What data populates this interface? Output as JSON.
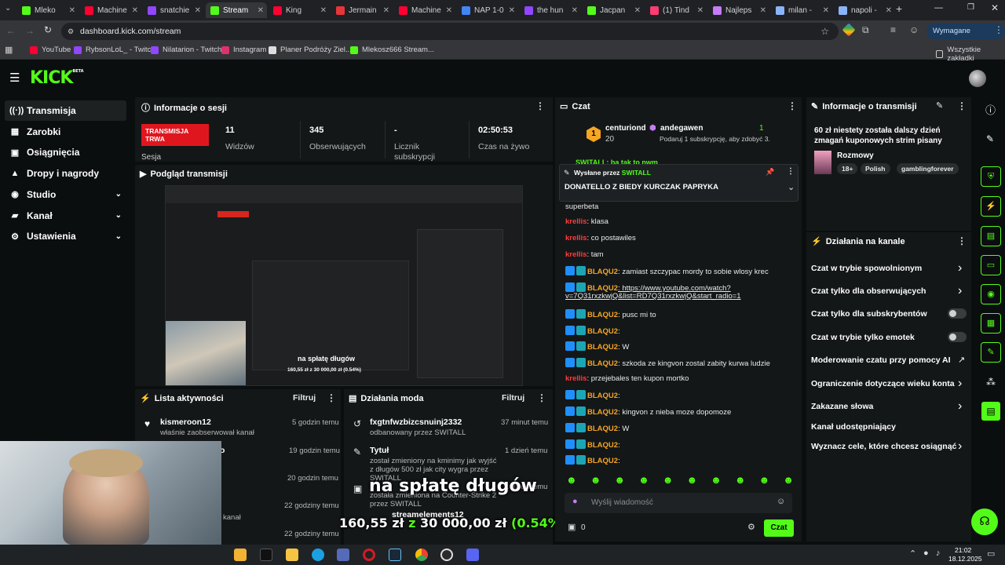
{
  "browser": {
    "tabs": [
      {
        "label": "Mleko",
        "color": "#53fc18"
      },
      {
        "label": "Machine",
        "color": "#ff0033"
      },
      {
        "label": "snatchie",
        "color": "#9146ff"
      },
      {
        "label": "Stream",
        "color": "#53fc18"
      },
      {
        "label": "King",
        "color": "#ff0033"
      },
      {
        "label": "Jermain",
        "color": "#e8343a"
      },
      {
        "label": "Machine",
        "color": "#ff0033"
      },
      {
        "label": "NAP 1-0",
        "color": "#4285f4"
      },
      {
        "label": "the hun",
        "color": "#9146ff"
      },
      {
        "label": "Jacpan",
        "color": "#53fc18"
      },
      {
        "label": "(1) Tind",
        "color": "#fe3c72"
      },
      {
        "label": "Najleps",
        "color": "#c57cf5"
      },
      {
        "label": "milan -",
        "color": "#8ab4f8"
      },
      {
        "label": "napoli -",
        "color": "#8ab4f8"
      }
    ],
    "url": "dashboard.kick.com/stream",
    "action_button": "Wymagane działanie",
    "bookmarks": [
      {
        "label": "YouTube",
        "color": "#ff0033"
      },
      {
        "label": "RybsonLoL_ - Twitch",
        "color": "#9146ff"
      },
      {
        "label": "Nilatarion - Twitch",
        "color": "#9146ff"
      },
      {
        "label": "Instagram",
        "color": "#e1306c"
      },
      {
        "label": "Planer Podróży Ziel...",
        "color": "#dddddd"
      },
      {
        "label": "Mlekosz666 Stream...",
        "color": "#53fc18"
      }
    ],
    "all_bookmarks": "Wszystkie zakładki"
  },
  "kick": {
    "logo": "KICK",
    "logo_sup": "BETA"
  },
  "sidebar": {
    "items": [
      {
        "label": "Transmisja",
        "icon": "((·))",
        "chevron": ""
      },
      {
        "label": "Zarobki",
        "icon": "▦",
        "chevron": ""
      },
      {
        "label": "Osiągnięcia",
        "icon": "▣",
        "chevron": ""
      },
      {
        "label": "Dropy i nagrody",
        "icon": "▲",
        "chevron": ""
      },
      {
        "label": "Studio",
        "icon": "◉",
        "chevron": "⌄"
      },
      {
        "label": "Kanał",
        "icon": "▰",
        "chevron": "⌄"
      },
      {
        "label": "Ustawienia",
        "icon": "⚙",
        "chevron": "⌄"
      }
    ]
  },
  "session": {
    "title": "Informacje o sesji",
    "live_badge": "TRANSMISJA TRWA",
    "session_label": "Sesja",
    "stats": [
      {
        "value": "11",
        "label": "Widzów"
      },
      {
        "value": "345",
        "label": "Obserwujących"
      },
      {
        "value": "-",
        "label": "Licznik subskrypcji"
      },
      {
        "value": "02:50:53",
        "label": "Czas na żywo"
      }
    ]
  },
  "preview": {
    "title": "Podgląd transmisji",
    "overlay_text": "na spłatę długów",
    "overlay_progress": "160,55 zł z 30 000,00 zł (0.54%)"
  },
  "activity": {
    "title": "Lista aktywności",
    "filter": "Filtruj",
    "items": [
      {
        "name": "kismeroon12",
        "sub": "właśnie zaobserwował kanał",
        "time": "5 godzin temu"
      },
      {
        "name": "o",
        "sub": "",
        "time": "19 godzin temu"
      },
      {
        "name": "",
        "sub": "",
        "time": "20 godzin temu"
      },
      {
        "name": "",
        "sub": "kanał",
        "time": "22 godziny temu"
      },
      {
        "name": "",
        "sub": "",
        "time": "22 godziny temu"
      }
    ]
  },
  "mod": {
    "title": "Działania moda",
    "filter": "Filtruj",
    "items": [
      {
        "name": "fxgtnfwzbizcsnuinj2332",
        "sub": "odbanowany przez SWITALL",
        "time": "37 minut temu"
      },
      {
        "name": "Tytuł",
        "sub": "został zmieniony na kminimy jak wyjść z długów 500 zł jak city wygra przez SWITALL",
        "time": "1 dzień temu"
      },
      {
        "name": "Kategoria",
        "sub": "została zmieniona na Counter-Strike 2 przez SWITALL",
        "time": "1 dzień temu"
      },
      {
        "name": "streamelements12",
        "sub": "",
        "time": ""
      }
    ]
  },
  "overlay_bottom": {
    "title": "na spłatę długów",
    "amount": "160,55 zł",
    "z": "z",
    "goal": "30 000,00 zł",
    "percent": "(0.54%)"
  },
  "chat": {
    "title": "Czat",
    "top_user": "centuriond",
    "top_count": "20",
    "top_user2": "andegawen",
    "top_count2": "1",
    "top_sub_text": "Podaruj 1 subskrypcję, aby zdobyć 3.",
    "pinned_by_label": "Wysłane przez",
    "pinned_by": "SWITALL",
    "pinned_text": "DONATELLO Z BIEDY KURCZAK PAPRYKA",
    "partial_top": "SWITALL: ba tak to nwm",
    "messages": [
      {
        "user": "",
        "text": "superbeta",
        "type": "plain"
      },
      {
        "user": "krellis",
        "text": ": klasa",
        "type": "red"
      },
      {
        "user": "krellis",
        "text": ": co postawiles",
        "type": "red"
      },
      {
        "user": "krellis",
        "text": ": tam",
        "type": "red"
      },
      {
        "user": "BLAQU2",
        "text": ": zamiast szczypac mordy to sobie wlosy krec",
        "type": "gold"
      },
      {
        "user": "BLAQU2",
        "text": ": https://www.youtube.com/watch?",
        "type": "gold"
      },
      {
        "user": "",
        "text": "v=7Q31rxzkwjQ&list=RD7Q31rxzkwjQ&start_radio=1",
        "type": "link"
      },
      {
        "user": "BLAQU2",
        "text": ": pusc mi to",
        "type": "gold"
      },
      {
        "user": "BLAQU2",
        "text": ":",
        "type": "gold"
      },
      {
        "user": "BLAQU2",
        "text": ": W",
        "type": "gold"
      },
      {
        "user": "BLAQU2",
        "text": ": szkoda ze kingvon zostal zabity kurwa ludzie",
        "type": "gold"
      },
      {
        "user": "krellis",
        "text": ": przejebales ten kupon mortko",
        "type": "red"
      },
      {
        "user": "BLAQU2",
        "text": ":",
        "type": "gold"
      },
      {
        "user": "BLAQU2",
        "text": ": kingvon z nieba moze dopomoze",
        "type": "gold"
      },
      {
        "user": "BLAQU2",
        "text": ": W",
        "type": "gold"
      },
      {
        "user": "BLAQU2",
        "text": ":",
        "type": "gold"
      },
      {
        "user": "BLAQU2",
        "text": ":",
        "type": "gold"
      }
    ],
    "input_placeholder": "Wyślij wiadomość",
    "points": "0",
    "send": "Czat"
  },
  "stream_info": {
    "title": "Informacje o transmisji",
    "stream_title": "60 zł niestety została dalszy dzień zmagań kuponowych strim pisany",
    "category": "Rozmowy",
    "tags": [
      "18+",
      "Polish",
      "gamblingforever"
    ]
  },
  "channel_actions": {
    "title": "Działania na kanale",
    "items": [
      {
        "label": "Czat w trybie spowolnionym",
        "control": "arrow"
      },
      {
        "label": "Czat tylko dla obserwujących",
        "control": "arrow"
      },
      {
        "label": "Czat tylko dla subskrybentów",
        "control": "toggle"
      },
      {
        "label": "Czat w trybie tylko emotek",
        "control": "toggle"
      },
      {
        "label": "Moderowanie czatu przy pomocy AI",
        "control": "chart"
      },
      {
        "label": "Ograniczenie dotyczące wieku konta",
        "control": "arrow"
      },
      {
        "label": "Zakazane słowa",
        "control": "arrow"
      },
      {
        "label": "Kanał udostępniający",
        "control": "none"
      },
      {
        "label": "Wyznacz cele, które chcesz osiągnąć",
        "control": "arrow"
      }
    ]
  },
  "taskbar": {
    "time": "21:02",
    "date": "18.12.2025"
  }
}
